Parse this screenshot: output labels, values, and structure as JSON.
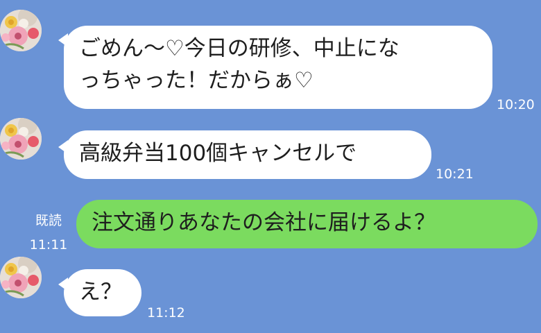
{
  "colors": {
    "background": "#6a93d6",
    "incoming_bubble": "#ffffff",
    "outgoing_bubble": "#7bdb5f"
  },
  "messages": [
    {
      "sender": "other",
      "avatar_icon": "flower-bouquet-avatar",
      "text": "ごめん〜♡今日の研修、中止にな\nっちゃった！だからぁ♡",
      "time": "10:20"
    },
    {
      "sender": "other",
      "avatar_icon": "flower-bouquet-avatar",
      "text": "高級弁当100個キャンセルで",
      "time": "10:21"
    },
    {
      "sender": "me",
      "read_label": "既読",
      "text": "注文通りあなたの会社に届けるよ？",
      "time": "11:11"
    },
    {
      "sender": "other",
      "avatar_icon": "flower-bouquet-avatar",
      "text": "え？",
      "time": "11:12"
    }
  ]
}
